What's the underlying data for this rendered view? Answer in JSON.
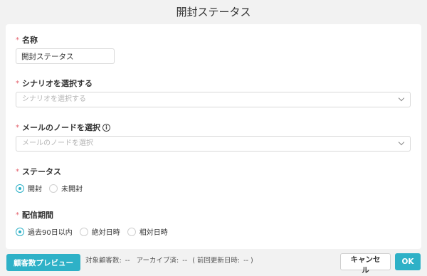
{
  "dialog": {
    "title": "開封ステータス"
  },
  "fields": {
    "name": {
      "label": "名称",
      "value": "開封ステータス"
    },
    "scenario": {
      "label": "シナリオを選択する",
      "placeholder": "シナリオを選択する"
    },
    "mail_node": {
      "label": "メールのノードを選択",
      "info_icon": "info-icon",
      "placeholder": "メールのノードを選択"
    },
    "status": {
      "label": "ステータス",
      "options": [
        {
          "label": "開封",
          "checked": true
        },
        {
          "label": "未開封",
          "checked": false
        }
      ]
    },
    "delivery_period": {
      "label": "配信期間",
      "options": [
        {
          "label": "過去90日以内",
          "checked": true
        },
        {
          "label": "絶対日時",
          "checked": false
        },
        {
          "label": "相対日時",
          "checked": false
        }
      ]
    }
  },
  "required_mark": "*",
  "footer": {
    "preview_button": "顧客数プレビュー",
    "target_customers_label": "対象顧客数:",
    "target_customers_value": "--",
    "archived_label": "アーカイブ済:",
    "archived_value": "--",
    "last_updated_label": "( 前回更新日時:",
    "last_updated_value": "-- )",
    "cancel_button": "キャンセル",
    "ok_button": "OK"
  },
  "colors": {
    "accent": "#2eb1c7",
    "required": "#e4606b",
    "background": "#f2f2f2"
  }
}
